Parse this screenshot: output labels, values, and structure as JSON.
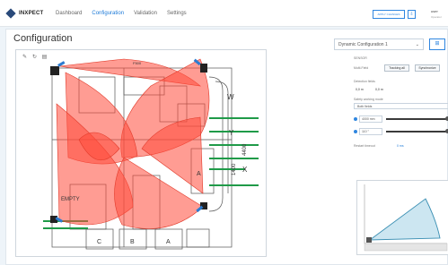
{
  "app": {
    "logo_text": "INXPECT"
  },
  "nav": {
    "items": [
      "Dashboard",
      "Configuration",
      "Validation",
      "Settings"
    ],
    "active": "Configuration"
  },
  "header": {
    "apply_label": "APPLY CHANGES",
    "user_name": "user",
    "user_sub": "Operator"
  },
  "page": {
    "title": "Configuration"
  },
  "floorplan": {
    "room_labels": [
      "W",
      "Y",
      "X",
      "EMPTY",
      "C",
      "B",
      "A",
      "A",
      "F500"
    ],
    "dimensions": [
      "1400",
      "4400"
    ]
  },
  "config": {
    "selected": "Dynamic Configuration 1",
    "sensor_label": "SENSOR",
    "row1_label": "Multi-Field",
    "toggle_a": "Tracking all",
    "toggle_b": "Synchronize",
    "detection_label": "Detection fields",
    "detection_values": [
      "0,0  m",
      "0,0  m"
    ],
    "safety_label": "Safety working mode",
    "safety_value": "Both fields",
    "slider1_value": "4000  mm",
    "slider2_value": "110  °",
    "restart_label": "Restart timeout",
    "restart_value": "0 ms"
  },
  "colors": {
    "accent": "#1e7bd8",
    "coverage": "#ff4a3a",
    "fov": "#3a8fb3"
  }
}
